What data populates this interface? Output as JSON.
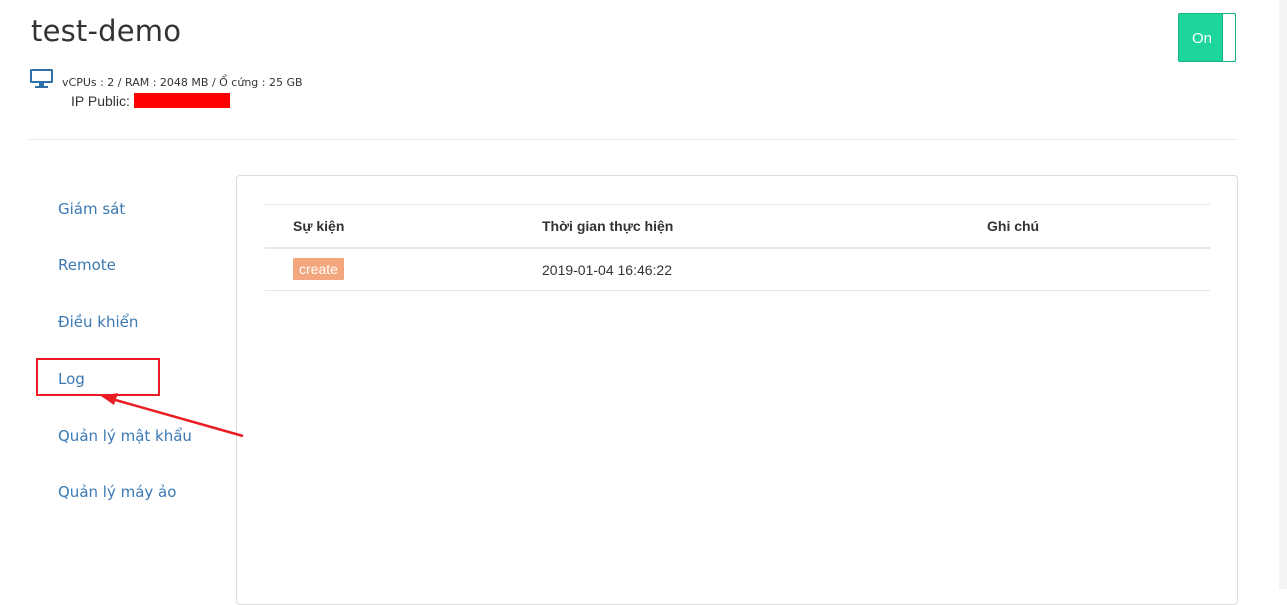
{
  "header": {
    "title": "test-demo",
    "toggle_label": "On",
    "specs": "vCPUs : 2 / RAM : 2048 MB / Ổ cứng : 25 GB",
    "ip_label": "IP Public:",
    "ip_value_redacted": true,
    "icons": {
      "server": "monitor-icon"
    }
  },
  "sidebar": {
    "items": [
      {
        "label": "Giám sát"
      },
      {
        "label": "Remote"
      },
      {
        "label": "Điều khiển"
      },
      {
        "label": "Log",
        "highlighted": true
      },
      {
        "label": "Quản lý mật khẩu"
      },
      {
        "label": "Quản lý máy ảo"
      }
    ]
  },
  "log_table": {
    "columns": [
      "Sự kiện",
      "Thời gian thực hiện",
      "Ghi chú"
    ],
    "rows": [
      {
        "event": "create",
        "time": "2019-01-04 16:46:22",
        "note": ""
      }
    ]
  },
  "colors": {
    "toggle_on": "#1cd69c",
    "link": "#3a79b4",
    "event_badge": "#f4a67e",
    "annotation": "#ec1c24"
  }
}
